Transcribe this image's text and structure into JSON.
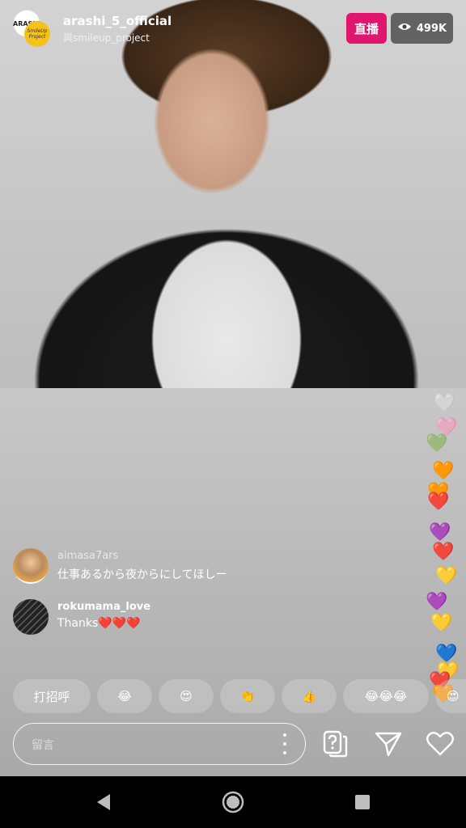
{
  "header": {
    "avatar_text_1": "ARASHI",
    "avatar_text_2": "SmileUp Project",
    "host_username": "arashi_5_official",
    "co_host_line": "與smileup_project",
    "live_label": "直播",
    "viewer_count": "499K",
    "viewer_icon": "eye-icon"
  },
  "comments": [
    {
      "username": "aimasa7ars",
      "message": "仕事あるから夜からにしてほしー"
    },
    {
      "username": "rokumama_love",
      "message": "Thanks❤️❤️❤️"
    }
  ],
  "reactions": [
    {
      "label": "打招呼"
    },
    {
      "label": "😂"
    },
    {
      "label": "😍"
    },
    {
      "label": "👏"
    },
    {
      "label": "👍"
    },
    {
      "label": "😂😂😂"
    },
    {
      "label": "😍"
    }
  ],
  "comment_input": {
    "placeholder": "留言",
    "more_icon": "more-vertical-icon"
  },
  "actions": {
    "question_icon": "question-sticker-icon",
    "share_icon": "send-icon",
    "like_icon": "heart-icon"
  },
  "floating_hearts": [
    "🤍",
    "🩷",
    "💚",
    "🧡",
    "🧡",
    "❤️",
    "💜",
    "❤️",
    "💛",
    "💜",
    "💛",
    "💙",
    "💛",
    "❤️",
    "🧡"
  ],
  "navbar": {
    "back_icon": "back-triangle-icon",
    "home_icon": "home-circle-icon",
    "recents_icon": "recents-square-icon"
  }
}
